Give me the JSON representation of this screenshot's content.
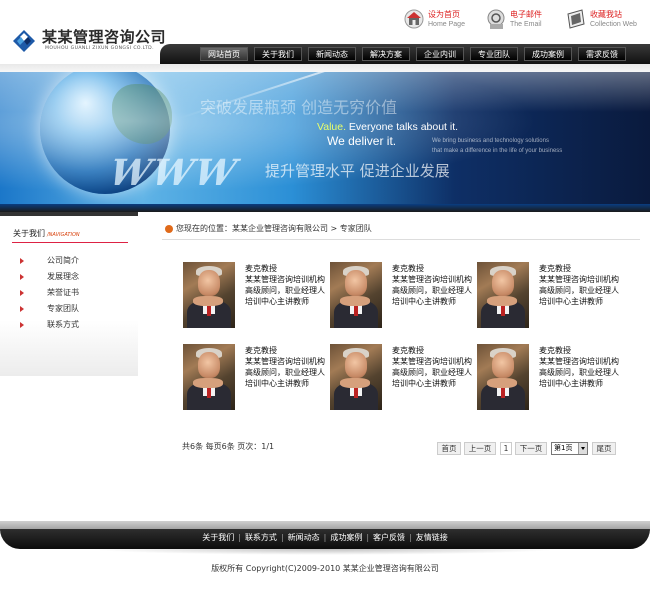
{
  "company": {
    "name_cn": "某某管理咨询公司",
    "name_en": "MOUHOU GUANLI ZIXUN GONGSI CO.LTD."
  },
  "quick_links": [
    {
      "label": "设为首页",
      "sub": "Home Page",
      "icon": "house-icon"
    },
    {
      "label": "电子邮件",
      "sub": "The Email",
      "icon": "email-icon"
    },
    {
      "label": "收藏我站",
      "sub": "Collection Web",
      "icon": "folder-icon"
    }
  ],
  "nav": [
    "网站首页",
    "关于我们",
    "新闻动态",
    "解决方案",
    "企业内训",
    "专业团队",
    "成功案例",
    "需求反馈"
  ],
  "banner": {
    "slogan1": "突破发展瓶颈 创造无穷价值",
    "value_word": "Value.",
    "value_line": " Everyone talks about it.",
    "deliver": "We deliver it.",
    "small1": "We bring business and technology solutions",
    "small2": "that make a difference in the life of your business",
    "slogan2": "提升管理水平 促进企业发展",
    "www": "WWW"
  },
  "sidebar": {
    "title": "关于我们",
    "title_en": "/NAVIGATION",
    "items": [
      "公司简介",
      "发展理念",
      "荣誉证书",
      "专家团队",
      "联系方式"
    ]
  },
  "breadcrumb": {
    "prefix": "您现在的位置：",
    "home": "某某企业管理咨询有限公司",
    "sep": " > ",
    "current": "专家团队"
  },
  "experts": [
    {
      "name": "麦克教授",
      "desc": "某某管理咨询培训机构高级顾问，职业经理人培训中心主讲教师"
    },
    {
      "name": "麦克教授",
      "desc": "某某管理咨询培训机构高级顾问，职业经理人培训中心主讲教师"
    },
    {
      "name": "麦克教授",
      "desc": "某某管理咨询培训机构高级顾问，职业经理人培训中心主讲教师"
    },
    {
      "name": "麦克教授",
      "desc": "某某管理咨询培训机构高级顾问，职业经理人培训中心主讲教师"
    },
    {
      "name": "麦克教授",
      "desc": "某某管理咨询培训机构高级顾问，职业经理人培训中心主讲教师"
    },
    {
      "name": "麦克教授",
      "desc": "某某管理咨询培训机构高级顾问，职业经理人培训中心主讲教师"
    }
  ],
  "pagination": {
    "info": "共6条  每页6条  页次：1/1",
    "first": "首页",
    "prev": "上一页",
    "current": "1",
    "next": "下一页",
    "select": "第1页",
    "last": "尾页"
  },
  "footer": {
    "links": [
      "关于我们",
      "联系方式",
      "新闻动态",
      "成功案例",
      "客户反馈",
      "友情链接"
    ],
    "copyright": "版权所有  Copyright(C)2009-2010 某某企业管理咨询有限公司"
  },
  "colors": {
    "accent_red": "#cc2222",
    "nav_dark": "#111111",
    "banner_blue": "#1b77c9"
  }
}
